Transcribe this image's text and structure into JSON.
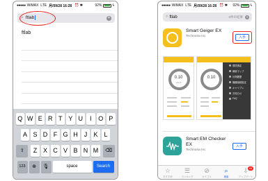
{
  "status_bar": {
    "carrier": "WiMAX",
    "network": "LTE",
    "time": "月/09/28 16:28",
    "battery": "92%",
    "battery_level": 0.92
  },
  "left_phone": {
    "search": {
      "value": "ftlab",
      "clear_icon": "clear-circle-icon"
    },
    "suggestion": "ftlab",
    "keyboard": {
      "row1": [
        "Q",
        "W",
        "E",
        "R",
        "T",
        "Y",
        "U",
        "I",
        "O",
        "P"
      ],
      "row2": [
        "A",
        "S",
        "D",
        "F",
        "G",
        "H",
        "J",
        "K",
        "L"
      ],
      "row3": [
        "Z",
        "X",
        "C",
        "V",
        "B",
        "N",
        "M"
      ],
      "key_123": "123",
      "key_space": "space",
      "key_search": "Search"
    },
    "highlight_color": "#e8231f"
  },
  "right_phone": {
    "search": {
      "value": "ftlab",
      "result_count": "6件の結果"
    },
    "apps": [
      {
        "name": "Smart Geiger EX",
        "developer": "Technoria Inc",
        "get_label": "入手"
      },
      {
        "name": "Smart EM Checker EX",
        "developer": "Technoria Inc",
        "get_label": "入手"
      }
    ],
    "screenshot_a": {
      "value": "0.10",
      "unit": "μSv/h"
    },
    "screenshot_b": {
      "value": "0.10",
      "menu": [
        "環境測定",
        "線量マップ",
        "計測履歴",
        "機器接続設定",
        "キャリブレ",
        "お知らせ",
        "FAQ"
      ]
    },
    "tabs": [
      {
        "label": "おすすめ",
        "icon": "star-icon",
        "active": false
      },
      {
        "label": "ランキング",
        "icon": "list-icon",
        "active": false
      },
      {
        "label": "カテゴリ",
        "icon": "compass-icon",
        "active": false
      },
      {
        "label": "検索",
        "icon": "search-icon",
        "active": true
      },
      {
        "label": "アップデート",
        "icon": "download-icon",
        "active": false,
        "badge": "44"
      }
    ],
    "accent_color": "#1e6cf0",
    "highlight_color": "#e8231f"
  }
}
